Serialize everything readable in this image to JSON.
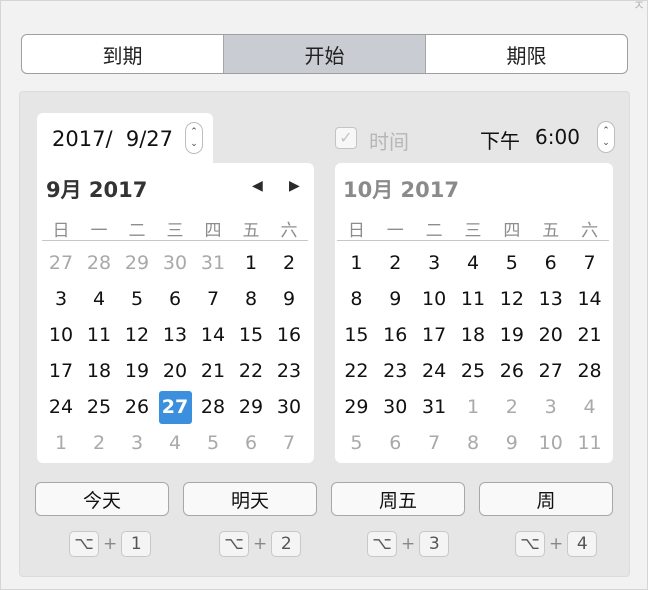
{
  "tabs": [
    {
      "label": "到期",
      "selected": false
    },
    {
      "label": "开始",
      "selected": true
    },
    {
      "label": "期限",
      "selected": false
    }
  ],
  "date_field": {
    "value": "2017/  9/27"
  },
  "time": {
    "checkbox_checked": true,
    "checkbox_enabled": false,
    "label": "时间",
    "ampm": "下午",
    "value": "6:00"
  },
  "calendars": [
    {
      "title": "9月 2017",
      "weekdays": [
        "日",
        "一",
        "二",
        "三",
        "四",
        "五",
        "六"
      ],
      "days": [
        {
          "d": "27",
          "other": true
        },
        {
          "d": "28",
          "other": true
        },
        {
          "d": "29",
          "other": true
        },
        {
          "d": "30",
          "other": true
        },
        {
          "d": "31",
          "other": true
        },
        {
          "d": "1"
        },
        {
          "d": "2"
        },
        {
          "d": "3"
        },
        {
          "d": "4"
        },
        {
          "d": "5"
        },
        {
          "d": "6"
        },
        {
          "d": "7"
        },
        {
          "d": "8"
        },
        {
          "d": "9"
        },
        {
          "d": "10"
        },
        {
          "d": "11"
        },
        {
          "d": "12"
        },
        {
          "d": "13"
        },
        {
          "d": "14"
        },
        {
          "d": "15"
        },
        {
          "d": "16"
        },
        {
          "d": "17"
        },
        {
          "d": "18"
        },
        {
          "d": "19"
        },
        {
          "d": "20"
        },
        {
          "d": "21"
        },
        {
          "d": "22"
        },
        {
          "d": "23"
        },
        {
          "d": "24"
        },
        {
          "d": "25"
        },
        {
          "d": "26"
        },
        {
          "d": "27",
          "selected": true
        },
        {
          "d": "28"
        },
        {
          "d": "29"
        },
        {
          "d": "30"
        },
        {
          "d": "1",
          "other": true
        },
        {
          "d": "2",
          "other": true
        },
        {
          "d": "3",
          "other": true
        },
        {
          "d": "4",
          "other": true
        },
        {
          "d": "5",
          "other": true
        },
        {
          "d": "6",
          "other": true
        },
        {
          "d": "7",
          "other": true
        }
      ]
    },
    {
      "title": "10月 2017",
      "weekdays": [
        "日",
        "一",
        "二",
        "三",
        "四",
        "五",
        "六"
      ],
      "days": [
        {
          "d": "1"
        },
        {
          "d": "2"
        },
        {
          "d": "3"
        },
        {
          "d": "4"
        },
        {
          "d": "5"
        },
        {
          "d": "6"
        },
        {
          "d": "7"
        },
        {
          "d": "8"
        },
        {
          "d": "9"
        },
        {
          "d": "10"
        },
        {
          "d": "11"
        },
        {
          "d": "12"
        },
        {
          "d": "13"
        },
        {
          "d": "14"
        },
        {
          "d": "15"
        },
        {
          "d": "16"
        },
        {
          "d": "17"
        },
        {
          "d": "18"
        },
        {
          "d": "19"
        },
        {
          "d": "20"
        },
        {
          "d": "21"
        },
        {
          "d": "22"
        },
        {
          "d": "23"
        },
        {
          "d": "24"
        },
        {
          "d": "25"
        },
        {
          "d": "26"
        },
        {
          "d": "27"
        },
        {
          "d": "28"
        },
        {
          "d": "29"
        },
        {
          "d": "30"
        },
        {
          "d": "31"
        },
        {
          "d": "1",
          "other": true
        },
        {
          "d": "2",
          "other": true
        },
        {
          "d": "3",
          "other": true
        },
        {
          "d": "4",
          "other": true
        },
        {
          "d": "5",
          "other": true
        },
        {
          "d": "6",
          "other": true
        },
        {
          "d": "7",
          "other": true
        },
        {
          "d": "8",
          "other": true
        },
        {
          "d": "9",
          "other": true
        },
        {
          "d": "10",
          "other": true
        },
        {
          "d": "11",
          "other": true
        }
      ]
    }
  ],
  "quick_buttons": [
    {
      "label": "今天",
      "key": "⌥",
      "plus": "+",
      "num": "1"
    },
    {
      "label": "明天",
      "key": "⌥",
      "plus": "+",
      "num": "2"
    },
    {
      "label": "周五",
      "key": "⌥",
      "plus": "+",
      "num": "3"
    },
    {
      "label": "周",
      "key": "⌥",
      "plus": "+",
      "num": "4"
    }
  ],
  "colors": {
    "selected_day": "#3b8fdc",
    "selected_tab": "#c9ccd2",
    "panel": "#e6e6e6"
  },
  "icons": {
    "prev": "◀",
    "next": "▶",
    "stepper_up": "⌃",
    "stepper_down": "⌄",
    "check": "✓"
  }
}
